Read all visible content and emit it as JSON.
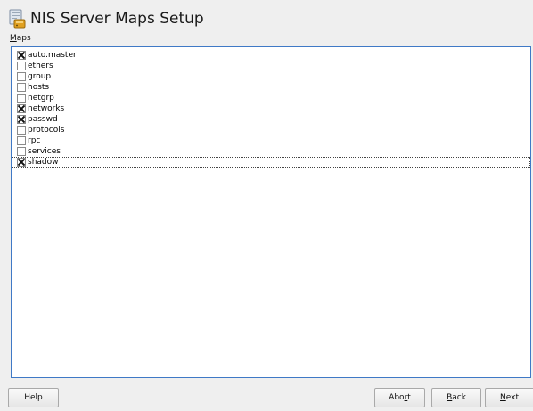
{
  "header": {
    "title": "NIS Server Maps Setup",
    "icon": "server-document-icon"
  },
  "maps": {
    "label_mnemonic": "M",
    "label_rest": "aps",
    "items": [
      {
        "label": "auto.master",
        "checked": true
      },
      {
        "label": "ethers",
        "checked": false
      },
      {
        "label": "group",
        "checked": false
      },
      {
        "label": "hosts",
        "checked": false
      },
      {
        "label": "netgrp",
        "checked": false
      },
      {
        "label": "networks",
        "checked": true
      },
      {
        "label": "passwd",
        "checked": true
      },
      {
        "label": "protocols",
        "checked": false
      },
      {
        "label": "rpc",
        "checked": false
      },
      {
        "label": "services",
        "checked": false
      },
      {
        "label": "shadow",
        "checked": true,
        "focused": true
      }
    ]
  },
  "buttons": {
    "help": "Help",
    "abort_pre": "Abo",
    "abort_mn": "r",
    "abort_post": "t",
    "back_mn": "B",
    "back_post": "ack",
    "next_mn": "N",
    "next_post": "ext"
  },
  "colors": {
    "list_border": "#3f79c6",
    "background": "#efefef"
  }
}
